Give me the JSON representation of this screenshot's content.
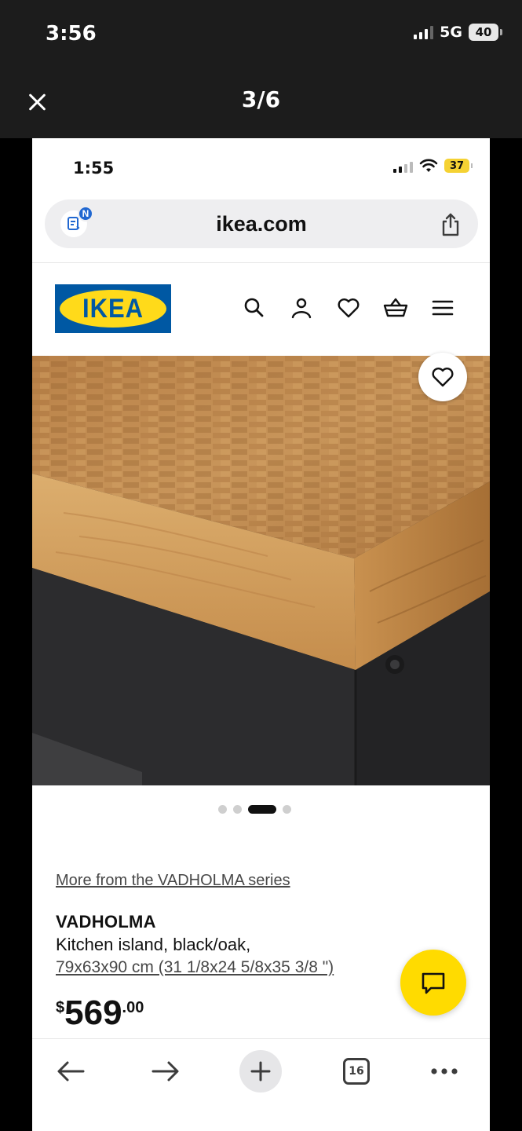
{
  "viewer": {
    "status_time": "3:56",
    "network": "5G",
    "battery": "40",
    "counter": "3/6",
    "close_icon": "close-icon"
  },
  "device": {
    "status_time": "1:55",
    "battery": "37",
    "battery_color": "#f5d233"
  },
  "browser": {
    "url": "ikea.com",
    "reader_badge": "N",
    "share_icon": "share-icon",
    "toolbar": {
      "back_icon": "back-arrow-icon",
      "forward_icon": "forward-arrow-icon",
      "new_tab_icon": "plus-icon",
      "tabs_count": "16",
      "more_icon": "more-icon"
    }
  },
  "site": {
    "logo_text": "IKEA",
    "brand_blue": "#0058a3",
    "brand_yellow": "#ffda1a",
    "header_icons": [
      "search-icon",
      "account-icon",
      "heart-icon",
      "basket-icon",
      "menu-icon"
    ]
  },
  "product": {
    "series_link": "More from the VADHOLMA series",
    "name": "VADHOLMA",
    "description": "Kitchen island, black/oak,",
    "dimensions": "79x63x90 cm (31 1/8x24 5/8x35 3/8 \")",
    "price": {
      "currency": "$",
      "whole": "569",
      "decimals": ".00"
    },
    "image_carousel": {
      "count": 4,
      "active_index": 2
    }
  },
  "chat": {
    "accent": "#ffdb00",
    "icon": "chat-icon"
  }
}
